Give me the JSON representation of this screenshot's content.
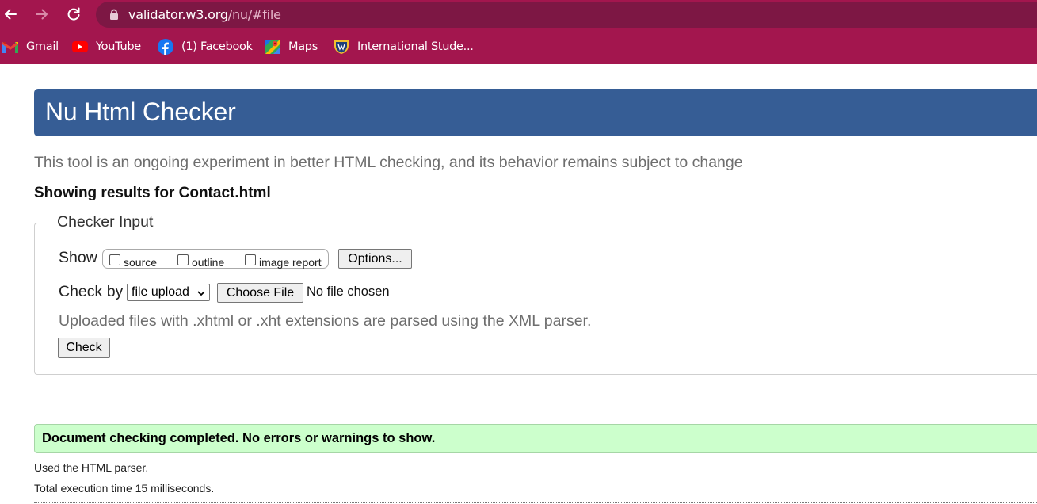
{
  "browser": {
    "url_host": "validator.w3.org",
    "url_path": "/nu/#file",
    "bookmarks": [
      {
        "label": "Gmail",
        "icon": "gmail-icon"
      },
      {
        "label": "YouTube",
        "icon": "youtube-icon"
      },
      {
        "label": "(1) Facebook",
        "icon": "facebook-icon"
      },
      {
        "label": "Maps",
        "icon": "maps-icon"
      },
      {
        "label": "International Stude...",
        "icon": "shield-icon"
      }
    ],
    "colors": {
      "toolbar": "#a3164e",
      "omnibox": "#7d1744"
    }
  },
  "page": {
    "title": "Nu Html Checker",
    "intro": "This tool is an ongoing experiment in better HTML checking, and its behavior remains subject to change",
    "results_for": "Showing results for Contact.html",
    "checker": {
      "legend": "Checker Input",
      "show_label": "Show",
      "show_options": [
        "source",
        "outline",
        "image report"
      ],
      "options_button": "Options...",
      "check_by_label": "Check by",
      "check_by_value": "file upload",
      "choose_file_button": "Choose File",
      "no_file_text": "No file chosen",
      "note": "Uploaded files with .xhtml or .xht extensions are parsed using the XML parser.",
      "check_button": "Check"
    },
    "result": {
      "message": "Document checking completed. No errors or warnings to show.",
      "parser": "Used the HTML parser.",
      "time": "Total execution time 15 milliseconds."
    },
    "colors": {
      "header": "#365d95",
      "success_bg": "#ccffcc"
    }
  }
}
